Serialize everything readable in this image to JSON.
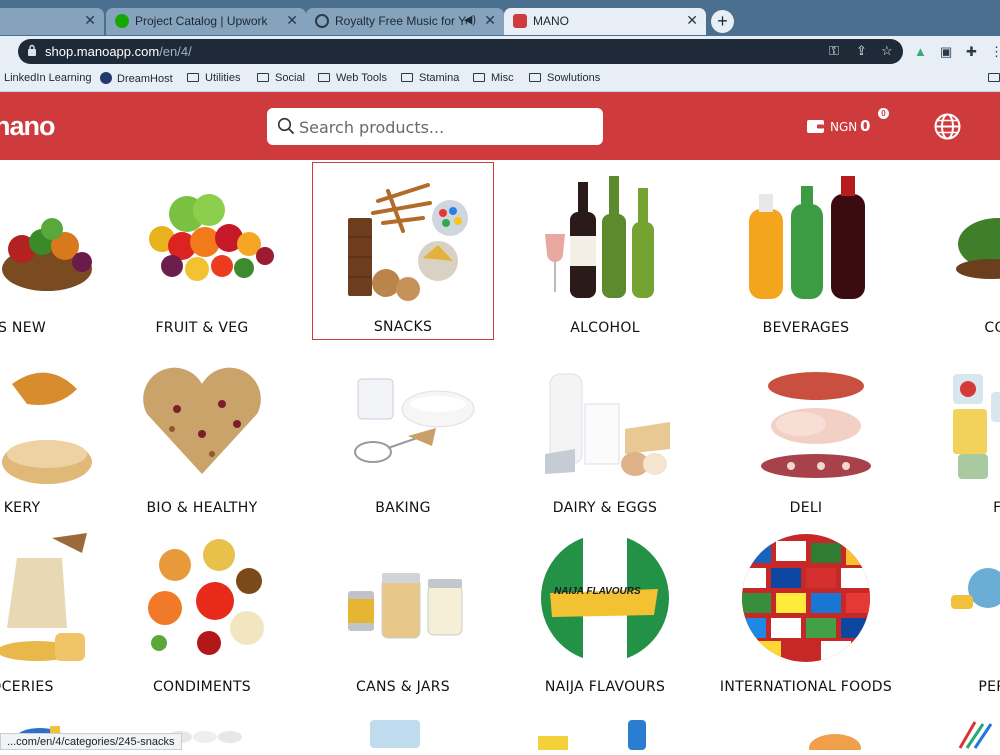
{
  "browser": {
    "tabs": [
      {
        "title": "",
        "active": false
      },
      {
        "title": "Project Catalog | Upwork",
        "active": false
      },
      {
        "title": "Royalty Free Music for You",
        "active": false
      },
      {
        "title": "MANO",
        "active": true
      }
    ],
    "url_host": "shop.manoapp.com",
    "url_path": "/en/4/",
    "bookmarks": [
      "LinkedIn Learning",
      "DreamHost",
      "Utilities",
      "Social",
      "Web Tools",
      "Stamina",
      "Misc",
      "Sowlutions"
    ],
    "status_link": "...com/en/4/categories/245-snacks"
  },
  "header": {
    "logo": "nano",
    "search_placeholder": "Search products...",
    "currency": "NGN",
    "balance": "0",
    "badge": "0"
  },
  "categories": [
    {
      "label": "S NEW",
      "icon": "new-basket-image"
    },
    {
      "label": "FRUIT & VEG",
      "icon": "fruit-veg-image"
    },
    {
      "label": "SNACKS",
      "icon": "snacks-image",
      "selected": true
    },
    {
      "label": "ALCOHOL",
      "icon": "alcohol-image"
    },
    {
      "label": "BEVERAGES",
      "icon": "beverages-image"
    },
    {
      "label": "COFFE",
      "icon": "coffee-image"
    },
    {
      "label": "KERY",
      "icon": "bakery-image"
    },
    {
      "label": "BIO & HEALTHY",
      "icon": "bio-healthy-image"
    },
    {
      "label": "BAKING",
      "icon": "baking-image"
    },
    {
      "label": "DAIRY & EGGS",
      "icon": "dairy-eggs-image"
    },
    {
      "label": "DELI",
      "icon": "deli-image"
    },
    {
      "label": "FRO",
      "icon": "frozen-image"
    },
    {
      "label": "OCERIES",
      "icon": "groceries-image"
    },
    {
      "label": "CONDIMENTS",
      "icon": "condiments-image"
    },
    {
      "label": "CANS & JARS",
      "icon": "cans-jars-image"
    },
    {
      "label": "NAIJA FLAVOURS",
      "icon": "naija-flavours-image",
      "banner": "NAIJA FLAVOURS"
    },
    {
      "label": "INTERNATIONAL FOODS",
      "icon": "international-foods-image"
    },
    {
      "label": "PERSON",
      "icon": "personal-care-image"
    }
  ],
  "colors": {
    "brand": "#cf3a3c",
    "selected_outline": "#d13b3b"
  }
}
